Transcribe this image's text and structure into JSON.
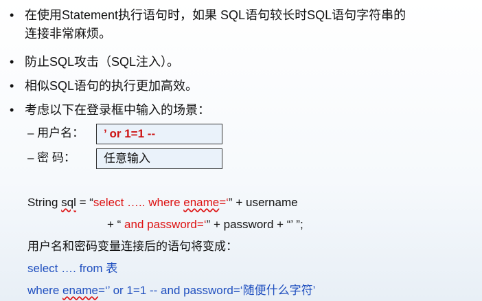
{
  "bullets": [
    {
      "line1": "在使用Statement执行语句时，如果 SQL语句较长时SQL语句字符串的",
      "line2": "连接非常麻烦。"
    },
    {
      "text": "防止SQL攻击（SQL注入）。"
    },
    {
      "text": "相似SQL语句的执行更加高效。"
    },
    {
      "text": "考虑以下在登录框中输入的场景："
    }
  ],
  "bullet_symbol": "•",
  "login": {
    "username_label": "– 用户名：",
    "username_value": "’ or 1=1 --",
    "password_label": "– 密    码：",
    "password_value": "任意输入"
  },
  "code": {
    "l1_a": "String ",
    "l1_b": "sql",
    "l1_c": " = “",
    "l1_d": "select  …..  where ",
    "l1_e": "ename",
    "l1_f": "=‘",
    "l1_g": "” + username",
    "l2_a": "+ “ ",
    "l2_b": "and password=‘",
    "l2_c": "” + password + “’ ”;",
    "l3": "用户名和密码变量连接后的语句将变成：",
    "l4": "select …. from  表",
    "l5_a": "where  ",
    "l5_b": "ename",
    "l5_c": "=‘’  or 1=1  -- and password=‘随便什么字符’"
  },
  "colors": {
    "red": "#dd1111",
    "blue": "#1f4fbf"
  }
}
